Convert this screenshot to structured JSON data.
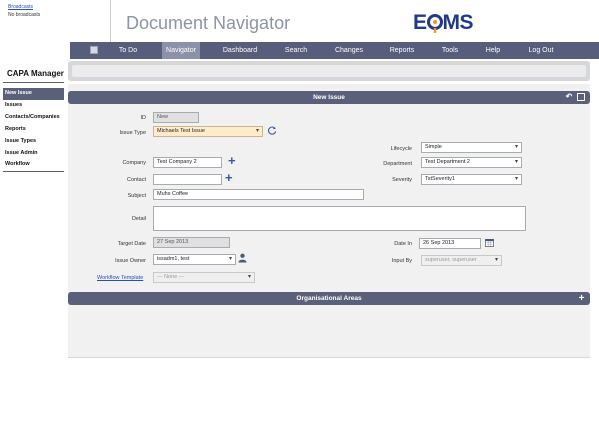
{
  "broadcasts": {
    "link": "Broadcasts",
    "message": "No broadcasts"
  },
  "header": {
    "title": "Document Navigator",
    "logo_left": "E",
    "logo_right": "MS"
  },
  "nav": {
    "items": [
      {
        "label": "To Do"
      },
      {
        "label": "Navigator"
      },
      {
        "label": "Dashboard"
      },
      {
        "label": "Search"
      },
      {
        "label": "Changes"
      },
      {
        "label": "Reports"
      },
      {
        "label": "Tools"
      },
      {
        "label": "Help"
      },
      {
        "label": "Log Out"
      }
    ],
    "active": "Navigator"
  },
  "sidebar": {
    "title": "CAPA Manager",
    "items": [
      {
        "label": "New Issue"
      },
      {
        "label": "Issues"
      },
      {
        "label": "Contacts/Companies"
      },
      {
        "label": "Reports"
      },
      {
        "label": "Issue Types"
      },
      {
        "label": "Issue Admin"
      },
      {
        "label": "Workflow"
      }
    ],
    "active": "New Issue"
  },
  "form": {
    "panel_title": "New Issue",
    "id_label": "ID",
    "id_value": "New",
    "issue_type_label": "Issue Type",
    "issue_type_value": "Michaels Test Issue",
    "lifecycle_label": "Lifecycle",
    "lifecycle_value": "Simple",
    "company_label": "Company",
    "company_value": "Test Company 2",
    "department_label": "Department",
    "department_value": "Test Department 2",
    "contact_label": "Contact",
    "contact_value": "",
    "severity_label": "Severity",
    "severity_value": "TstSeverity1",
    "subject_label": "Subject",
    "subject_value": "Muhs Coffee",
    "detail_label": "Detail",
    "detail_value": "",
    "target_date_label": "Target Date",
    "target_date_value": "27 Sep 2013",
    "date_in_label": "Date In",
    "date_in_value": "26 Sep 2013",
    "issue_owner_label": "Issue Owner",
    "issue_owner_value": "issadm1, test",
    "input_by_label": "Input By",
    "input_by_value": "superuser, superuser",
    "workflow_template_label": "Workflow Template",
    "workflow_template_value": "--- None ---"
  },
  "org_areas": {
    "title": "Organisational Areas"
  },
  "colors": {
    "nav_bg": "#575e7b",
    "panel_head": "#5a607a",
    "logo_blue": "#223a86",
    "logo_orange": "#f39a1e"
  }
}
